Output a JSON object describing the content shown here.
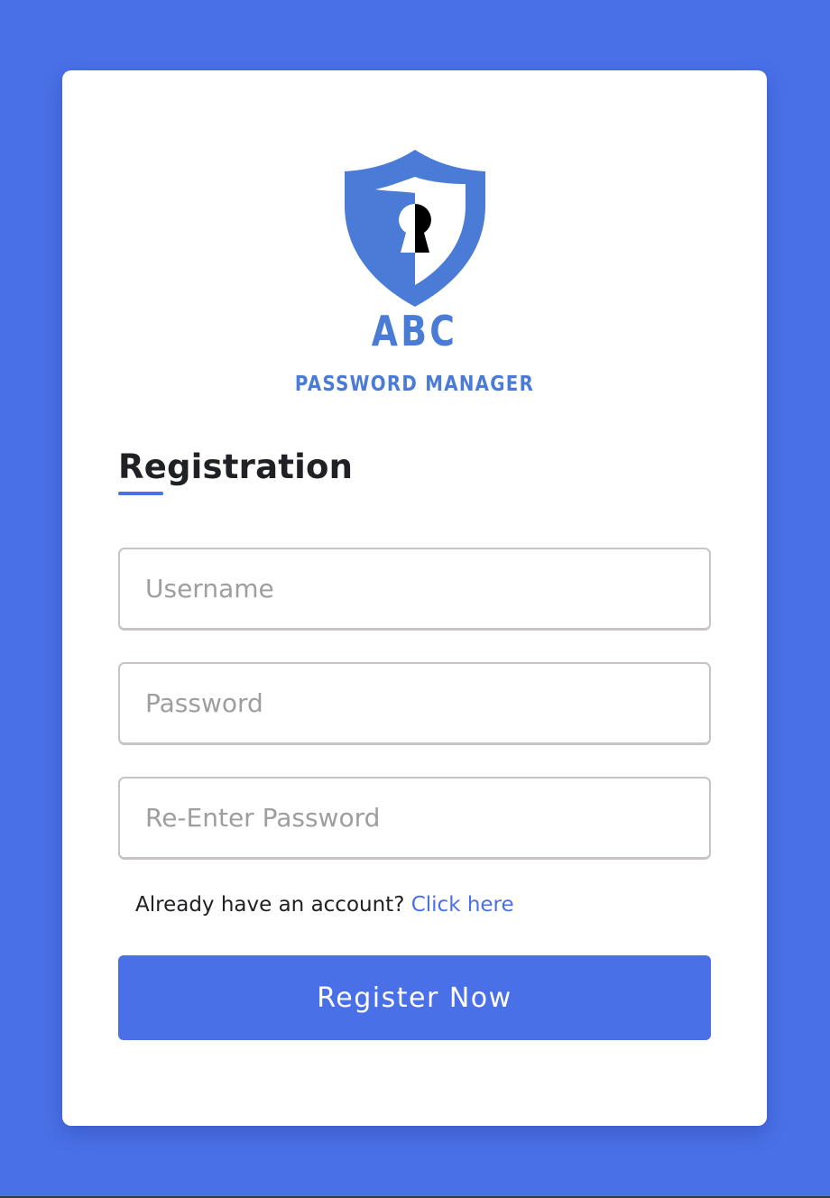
{
  "brand": {
    "name": "ABC",
    "subtitle": "PASSWORD MANAGER",
    "logo_icon": "shield-keyhole-icon",
    "color": "#4a7bd6"
  },
  "form": {
    "title": "Registration",
    "username_placeholder": "Username",
    "password_placeholder": "Password",
    "reenter_placeholder": "Re-Enter Password",
    "signin_prompt": "Already have an account?",
    "signin_link": "Click here",
    "submit_label": "Register Now"
  },
  "theme": {
    "background": "#4a70e8",
    "accent": "#4a70e8",
    "card": "#ffffff"
  }
}
